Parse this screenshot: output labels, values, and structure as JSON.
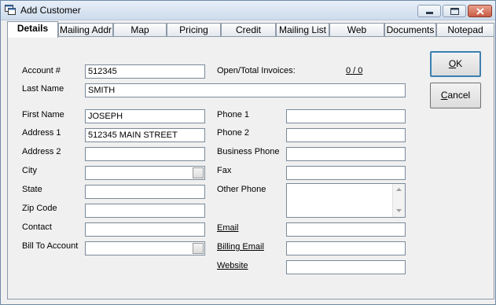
{
  "window": {
    "title": "Add Customer"
  },
  "tabs": [
    {
      "label": "Details",
      "active": true
    },
    {
      "label": "Mailing Addr"
    },
    {
      "label": "Map"
    },
    {
      "label": "Pricing"
    },
    {
      "label": "Credit"
    },
    {
      "label": "Mailing List"
    },
    {
      "label": "Web"
    },
    {
      "label": "Documents"
    },
    {
      "label": "Notepad"
    }
  ],
  "fields": {
    "account": {
      "label": "Account #",
      "value": "512345"
    },
    "open_invoices": {
      "label": "Open/Total Invoices:",
      "value": "0 / 0"
    },
    "last_name": {
      "label": "Last Name",
      "value": "SMITH"
    },
    "first_name": {
      "label": "First Name",
      "value": "JOSEPH"
    },
    "address1": {
      "label": "Address 1",
      "value": "512345 MAIN STREET"
    },
    "address2": {
      "label": "Address 2",
      "value": ""
    },
    "city": {
      "label": "City",
      "value": ""
    },
    "state": {
      "label": "State",
      "value": ""
    },
    "zip": {
      "label": "Zip Code",
      "value": ""
    },
    "contact": {
      "label": "Contact",
      "value": ""
    },
    "bill_to": {
      "label": "Bill To Account",
      "value": ""
    },
    "phone1": {
      "label": "Phone 1",
      "value": ""
    },
    "phone2": {
      "label": "Phone 2",
      "value": ""
    },
    "business_phone": {
      "label": "Business Phone",
      "value": ""
    },
    "fax": {
      "label": "Fax",
      "value": ""
    },
    "other_phone": {
      "label": "Other Phone",
      "value": ""
    },
    "email": {
      "label": "Email",
      "value": ""
    },
    "billing_email": {
      "label": "Billing Email",
      "value": ""
    },
    "website": {
      "label": "Website",
      "value": ""
    }
  },
  "buttons": {
    "ok": {
      "prefix": "",
      "mnemonic": "O",
      "rest": "K"
    },
    "cancel": {
      "prefix": "",
      "mnemonic": "C",
      "rest": "ancel"
    }
  },
  "colors": {
    "window_border": "#6f8aaa",
    "default_button_border": "#3c7fb1",
    "close_button": "#c85b45"
  }
}
